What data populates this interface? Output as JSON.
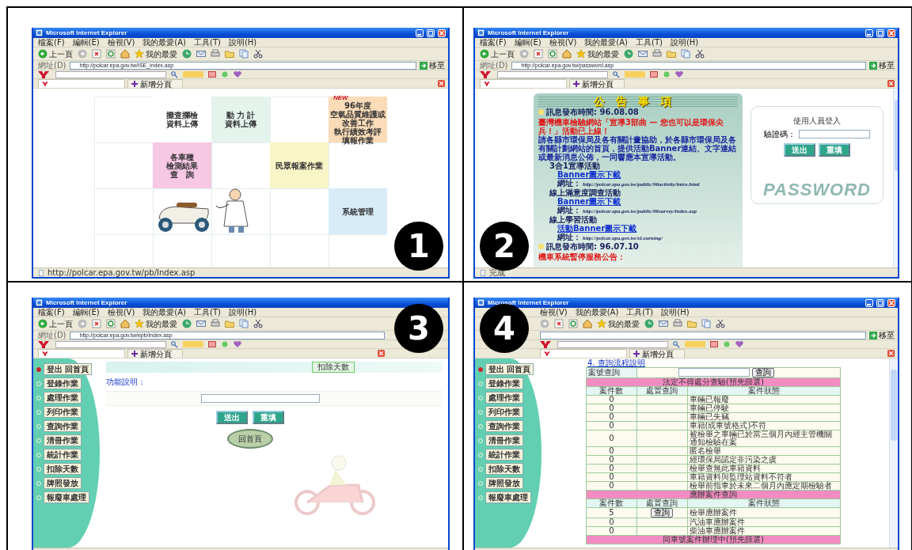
{
  "panels": [
    {
      "kind": "tiles",
      "number": "1",
      "browser": {
        "title": "Microsoft Internet Explorer",
        "menus": [
          "檔案(F)",
          "編輯(E)",
          "檢視(V)",
          "我的最愛(A)",
          "工具(T)",
          "說明(H)"
        ],
        "back": "上一頁",
        "favorites": "我的最愛",
        "address_label": "網址(D)",
        "url": "http://polcar.epa.gov.tw/ISE_index.asp",
        "go": "移至",
        "new_tab": "新增分頁",
        "status": "http://polcar.epa.gov.tw/pb/Index.asp"
      },
      "tiles": [
        {
          "lines": [
            "攤查攔檢",
            "資料上傳"
          ],
          "color": "#ffffff"
        },
        {
          "lines": [
            "動 力 計",
            "資料上傳"
          ],
          "color": "#e4f3ec"
        },
        {
          "badge": "NEW",
          "lines": [
            "96年度",
            "空氣品質維護或",
            "改善工作",
            "執行績效考評",
            "填報作業"
          ],
          "color": "#fbdcb8"
        },
        {
          "lines": [
            "各車種",
            "檢測結果",
            "查　詢"
          ],
          "color": "#f7c8e4"
        },
        {
          "lines": [
            "民眾報案作業"
          ],
          "color": "#f8f5c6"
        },
        {
          "lines": [
            "系統管理"
          ],
          "color": "#d8ecf8"
        }
      ]
    },
    {
      "kind": "notice",
      "number": "2",
      "browser": {
        "title": "Microsoft Internet Explorer",
        "menus": [
          "檔案(F)",
          "編輯(E)",
          "檢視(V)",
          "我的最愛(A)",
          "工具(T)",
          "說明(H)"
        ],
        "back": "上一頁",
        "favorites": "我的最愛",
        "address_label": "網址(D)",
        "url": "http://polcar.epa.gov.tw/password.asp",
        "go": "移至",
        "new_tab": "新增分頁",
        "status": "完成"
      },
      "notice": {
        "title": "公告事項",
        "posts": [
          {
            "time": "訊息發布時間: 96.08.08",
            "headline": "臺灣機車檢驗網站「宣導3部曲 — 您也可以是環保尖兵！」活動已上線！",
            "body": "請各縣市環保局及各有關計畫協助，於各縣市環保局及各有關計劃網站的首頁，提供活動Banner連結、文字連結或最新消息公佈，一同響應本宣導活動。",
            "activities": [
              {
                "name": "3合1宣導活動",
                "link": "Banner圖示下載",
                "url_label": "網址：",
                "url": "http://polcar.epa.gov.tw/public/96activity/intro.html"
              },
              {
                "name": "線上滿意度調查活動",
                "link": "Banner圖示下載",
                "url_label": "網址：",
                "url": "http://polcar.epa.gov.tw/public/96survey/index.asp"
              },
              {
                "name": "線上學習活動",
                "link": "活動Banner圖示下載",
                "url_label": "網址：",
                "url": "http://polcar.epa.gov.tw/eLearning/"
              }
            ]
          },
          {
            "time": "訊息發布時間: 96.07.10",
            "headline": "機車系統暫停服務公告："
          }
        ]
      },
      "login": {
        "title": "使用人員登入",
        "field_label": "驗證碼：",
        "buttons": [
          "送出",
          "重填"
        ],
        "watermark": "PASSWORD"
      }
    },
    {
      "kind": "form",
      "number": "3",
      "browser": {
        "title": "Microsoft Internet Explorer",
        "menus": [
          "檔案(F)",
          "編輯(E)",
          "檢視(V)",
          "我的最愛(A)",
          "工具(T)",
          "說明(H)"
        ],
        "back": "上一頁",
        "favorites": "我的最愛",
        "address_label": "網址(D)",
        "url": "http://polcar.epa.gov.tw/epb/index.asp",
        "new_tab": "新增分頁"
      },
      "sidebar": [
        {
          "label": "登出 回首頁",
          "selected": true
        },
        {
          "label": "登錄作業",
          "selected": false
        },
        {
          "label": "處理作業",
          "selected": false
        },
        {
          "label": "列印作業",
          "selected": false
        },
        {
          "label": "查詢作業",
          "selected": false
        },
        {
          "label": "清冊作業",
          "selected": false
        },
        {
          "label": "統計作業",
          "selected": false
        },
        {
          "label": "扣除天數",
          "selected": false
        },
        {
          "label": "牌照發放",
          "selected": false
        },
        {
          "label": "報廢車處理",
          "selected": false
        }
      ],
      "form": {
        "section": "扣除天數",
        "heading": "功能說明：",
        "buttons": [
          "送出",
          "重填"
        ],
        "home": "回首頁"
      }
    },
    {
      "kind": "table",
      "number": "4",
      "browser": {
        "title": "Microsoft Internet Explorer",
        "menus": [
          "檢視(V)",
          "我的最愛(A)",
          "工具(T)",
          "說明(H)"
        ],
        "favorites": "我的最愛",
        "go": "移至",
        "new_tab": "新增分頁"
      },
      "sidebar": [
        {
          "label": "登出 回首頁",
          "selected": true
        },
        {
          "label": "登錄作業",
          "selected": false
        },
        {
          "label": "處理作業",
          "selected": false
        },
        {
          "label": "列印作業",
          "selected": false
        },
        {
          "label": "查詢作業",
          "selected": false
        },
        {
          "label": "清冊作業",
          "selected": false
        },
        {
          "label": "統計作業",
          "selected": false
        },
        {
          "label": "扣除天數",
          "selected": false
        },
        {
          "label": "牌照發放",
          "selected": false
        },
        {
          "label": "報廢車處理",
          "selected": false
        }
      ],
      "table": {
        "link": "4. 查詢流程說明",
        "search_label": "案號查詢",
        "search_button": "查詢",
        "sections": [
          {
            "title": "法定不得處分查驗(預先篩選)",
            "columns": [
              "案件數",
              "處置查詢",
              "案件狀態"
            ],
            "rows": [
              {
                "count": "0",
                "status": "車輛已報廢"
              },
              {
                "count": "0",
                "status": "車輛已停駛"
              },
              {
                "count": "0",
                "status": "車輛已失竊"
              },
              {
                "count": "0",
                "status": "車籍(或車號格式)不符"
              },
              {
                "count": "0",
                "status": "被檢舉之車輛已於當三個月內經主管機關通知檢驗在案"
              },
              {
                "count": "0",
                "status": "匿名檢舉"
              },
              {
                "count": "0",
                "status": "經環保局認定非污染之虞"
              },
              {
                "count": "0",
                "status": "檢舉查無此車籍資料"
              },
              {
                "count": "0",
                "status": "車籍資料與監理站資料不符者"
              },
              {
                "count": "0",
                "status": "檢舉前指車於未來二個月內應定期檢驗者"
              }
            ]
          },
          {
            "title": "應辦案件查詢",
            "columns": [
              "案件數",
              "處置查詢",
              "案件狀態"
            ],
            "rows": [
              {
                "count": "5",
                "action": "查詢",
                "status": "檢舉應辦案件"
              },
              {
                "count": "0",
                "status": "汽油車應辦案件"
              },
              {
                "count": "0",
                "status": "柴油車應辦案件"
              }
            ]
          },
          {
            "title": "同車號案件辦理中(預先篩選)"
          }
        ]
      }
    }
  ]
}
